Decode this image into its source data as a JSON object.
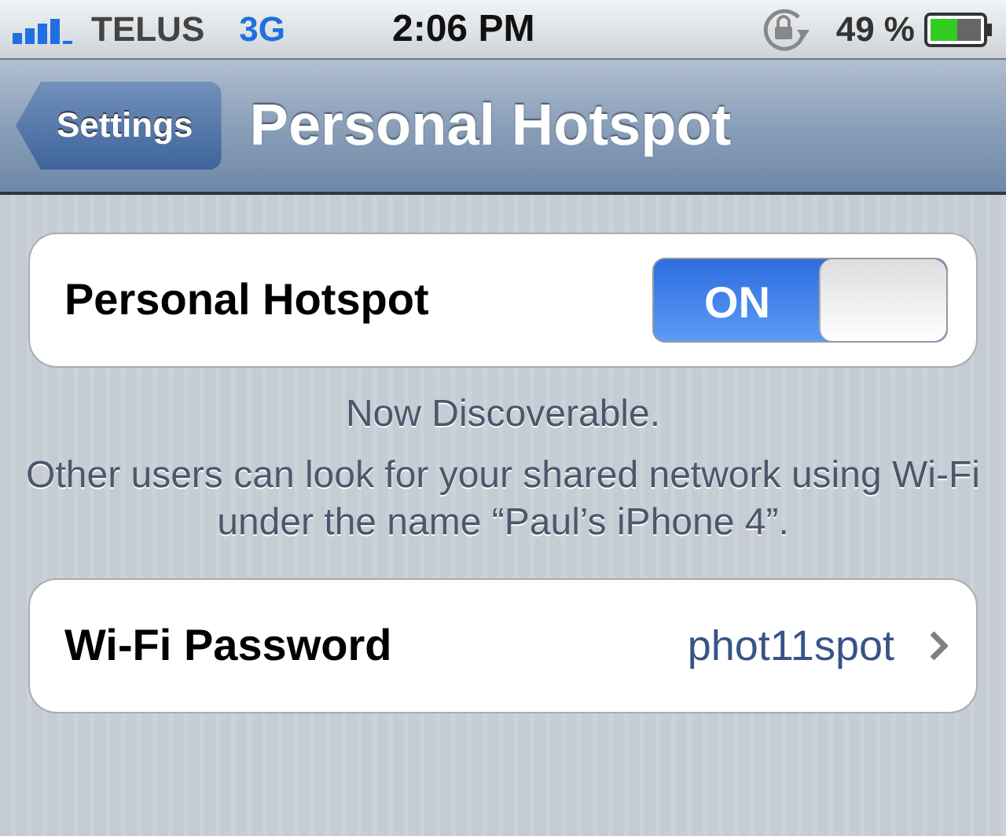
{
  "status_bar": {
    "carrier": "TELUS",
    "network": "3G",
    "time": "2:06 PM",
    "battery": "49 %"
  },
  "nav_bar": {
    "back": "Settings",
    "title": "Personal Hotspot"
  },
  "hotspot": {
    "label": "Personal Hotspot",
    "on": true,
    "toggle_label": "ON"
  },
  "footer": {
    "status": "Now Discoverable.",
    "description": "Other users can look for your shared network using Wi-Fi under the name “Paul’s iPhone 4”."
  },
  "wifi_password": {
    "label": "Wi-Fi Password",
    "value": "phot11spot"
  }
}
